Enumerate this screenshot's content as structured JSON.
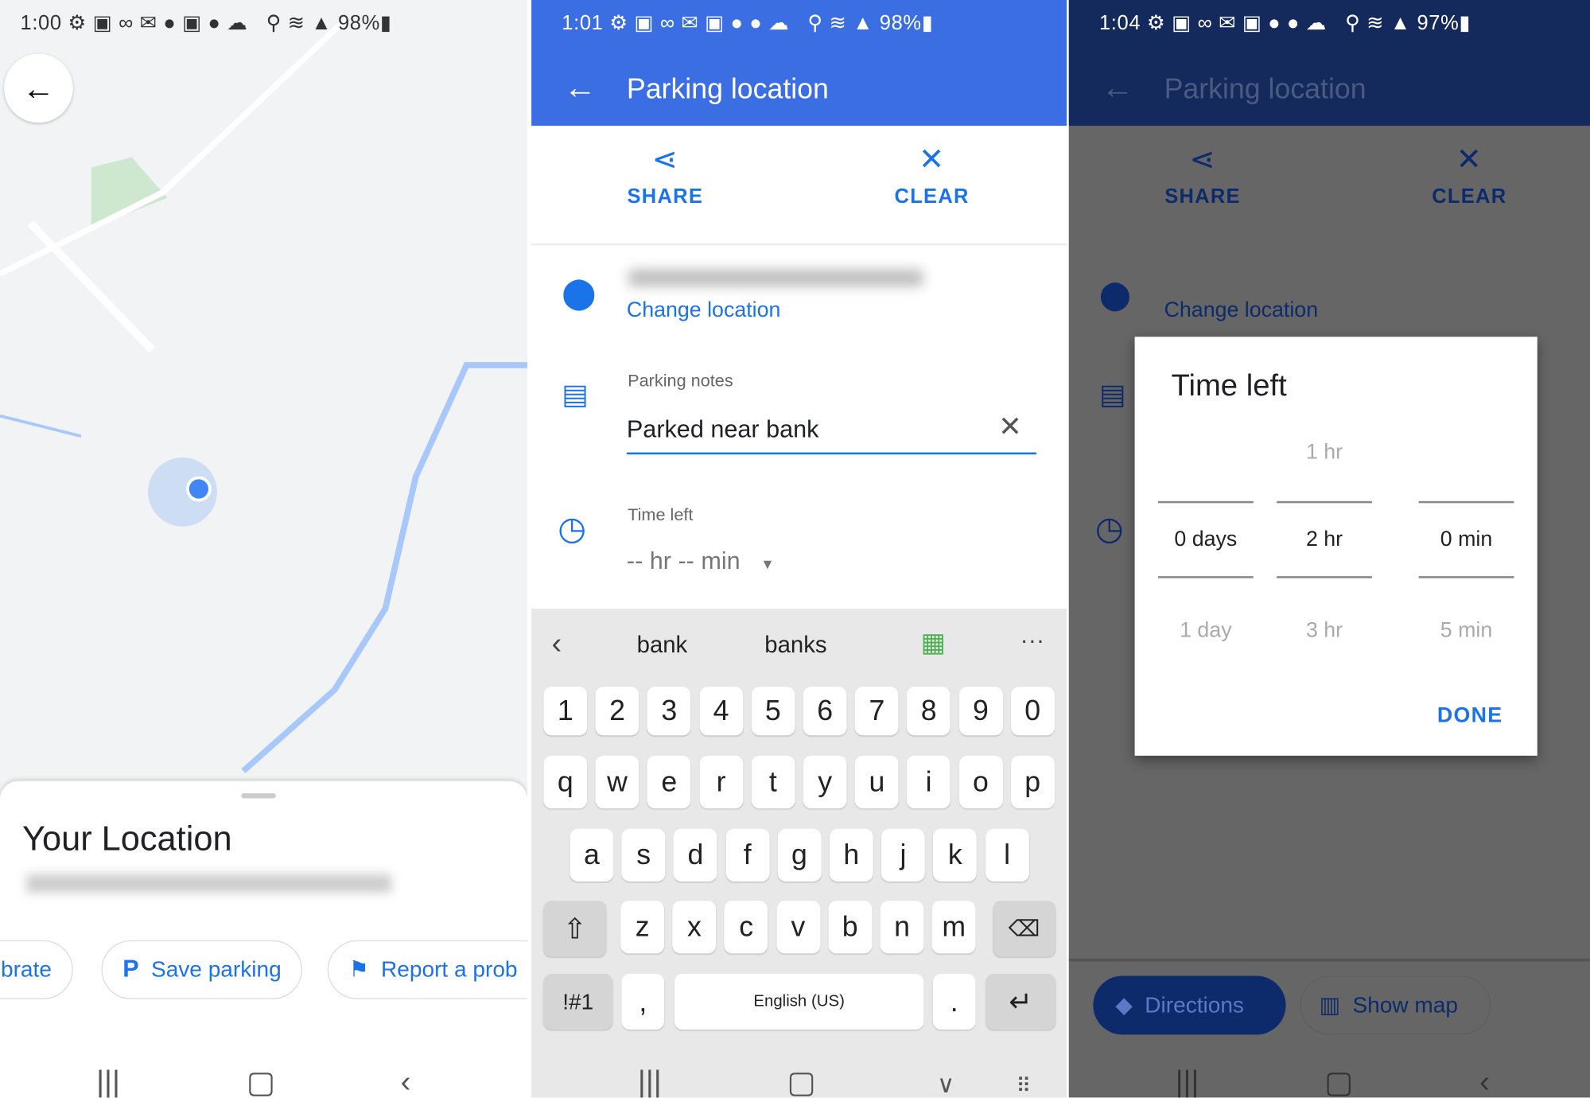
{
  "panel1": {
    "status": {
      "time": "1:00",
      "battery": "98%"
    },
    "sheet_title": "Your Location",
    "chips": [
      {
        "label": "librate",
        "icon": "calibrate-icon"
      },
      {
        "label": "Save parking",
        "icon": "parking-icon"
      },
      {
        "label": "Report a prob",
        "icon": "report-icon"
      }
    ]
  },
  "panel2": {
    "status": {
      "time": "1:01",
      "battery": "98%"
    },
    "title": "Parking location",
    "share_label": "SHARE",
    "clear_label": "CLEAR",
    "change_location": "Change location",
    "notes_label": "Parking notes",
    "notes_value": "Parked near bank",
    "time_label": "Time left",
    "time_value": "-- hr -- min",
    "suggestions": [
      "bank",
      "banks"
    ],
    "keyboard": {
      "numbers": [
        "1",
        "2",
        "3",
        "4",
        "5",
        "6",
        "7",
        "8",
        "9",
        "0"
      ],
      "row1": [
        "q",
        "w",
        "e",
        "r",
        "t",
        "y",
        "u",
        "i",
        "o",
        "p"
      ],
      "row2": [
        "a",
        "s",
        "d",
        "f",
        "g",
        "h",
        "j",
        "k",
        "l"
      ],
      "row3": [
        "z",
        "x",
        "c",
        "v",
        "b",
        "n",
        "m"
      ],
      "symbols": "!#1",
      "comma": ",",
      "space": "English (US)",
      "period": "."
    }
  },
  "panel3": {
    "status": {
      "time": "1:04",
      "battery": "97%"
    },
    "title": "Parking location",
    "share_label": "SHARE",
    "clear_label": "CLEAR",
    "change_location": "Change location",
    "dialog": {
      "title": "Time left",
      "days": {
        "prev": "",
        "selected": "0 days",
        "next": "1 day"
      },
      "hours": {
        "prev": "1 hr",
        "selected": "2 hr",
        "next": "3 hr"
      },
      "minutes": {
        "prev": "",
        "selected": "0 min",
        "next": "5 min"
      },
      "done": "DONE"
    },
    "directions": "Directions",
    "show_map": "Show map"
  },
  "colors": {
    "accent": "#1a73e8",
    "appbar": "#3b6ee3",
    "appbar_dim": "#152a5c",
    "keyboard": "#e8e8e8"
  }
}
